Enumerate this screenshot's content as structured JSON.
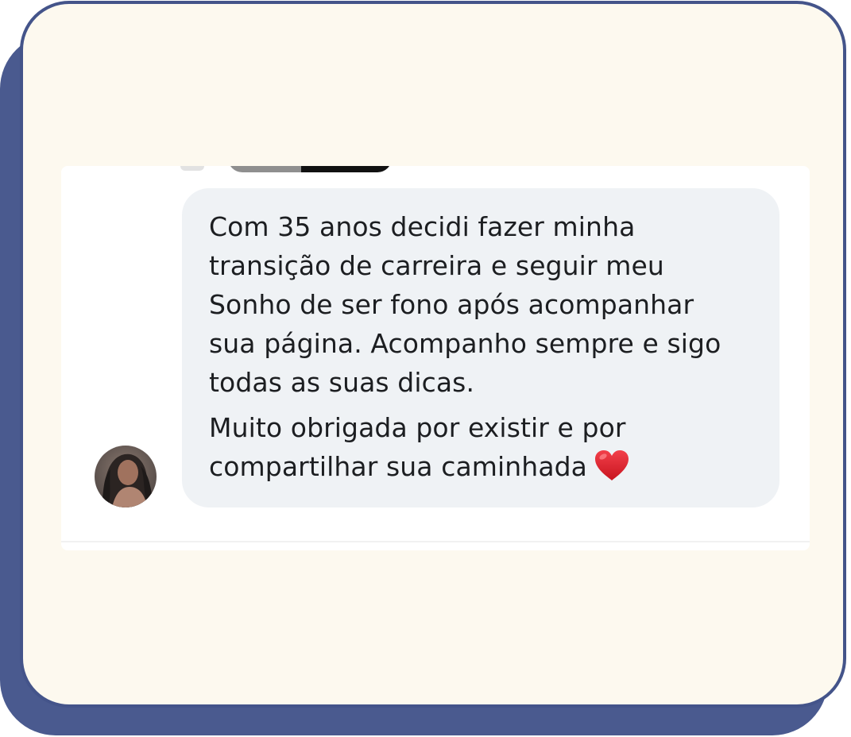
{
  "comment": {
    "paragraph_1": "Com 35 anos decidi fazer minha\ntransição de carreira e seguir meu\nSonho de ser fono após acompanhar\nsua página. Acompanho sempre e sigo\ntodas as suas dicas.",
    "paragraph_2": "Muito obrigada por existir e por\ncompartilhar sua caminhada",
    "emoji_icon": "red-heart-icon"
  },
  "colors": {
    "card_background": "#fdf9ef",
    "card_border": "#44548a",
    "card_shadow": "#4a5a8f",
    "bubble_background": "#eff2f5",
    "text": "#1c1e21",
    "heart": "#e0232e"
  }
}
